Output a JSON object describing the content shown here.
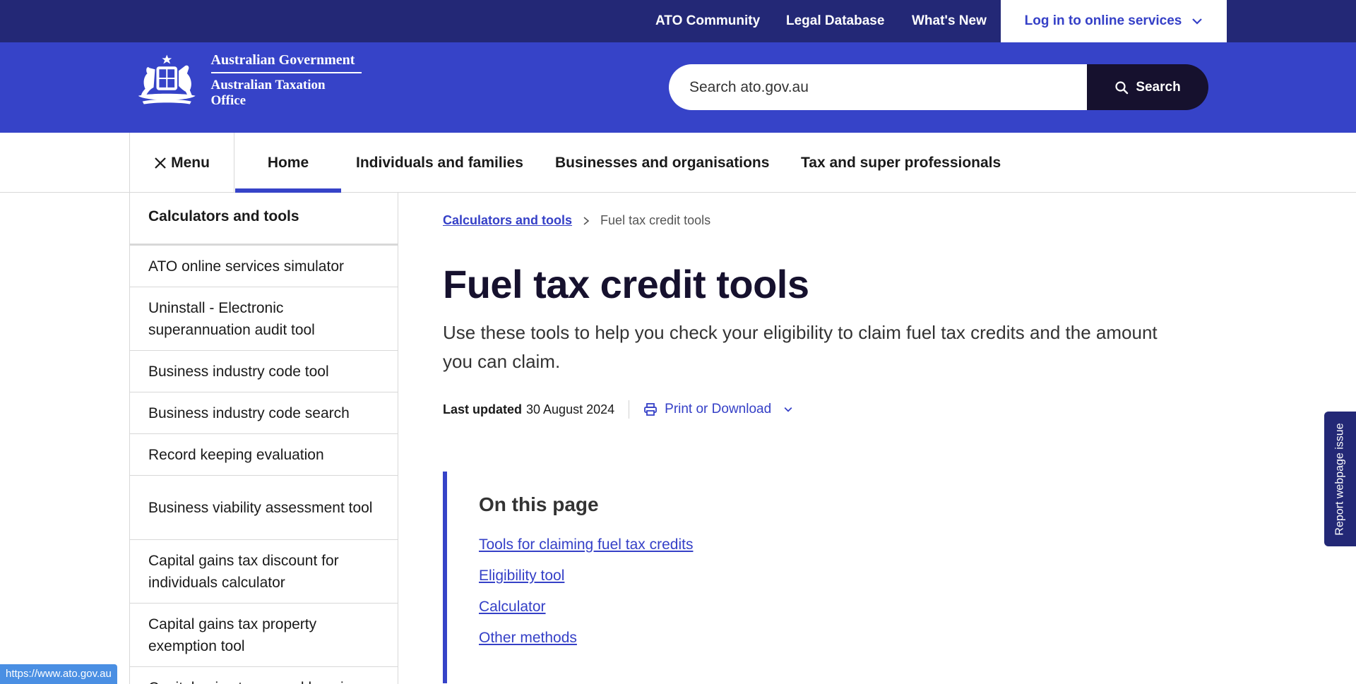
{
  "utility_bar": {
    "links": [
      "ATO Community",
      "Legal Database",
      "What's New"
    ],
    "login_label": "Log in to online services"
  },
  "header": {
    "logo_line1": "Australian Government",
    "logo_line2": "Australian Taxation Office",
    "search_placeholder": "Search ato.gov.au",
    "search_button": "Search"
  },
  "nav": {
    "menu_label": "Menu",
    "tabs": [
      "Home",
      "Individuals and families",
      "Businesses and organisations",
      "Tax and super professionals"
    ]
  },
  "sidebar": {
    "heading": "Calculators and tools",
    "items": [
      "ATO online services simulator",
      "Uninstall - Electronic superannuation audit tool",
      "Business industry code tool",
      "Business industry code search",
      "Record keeping evaluation",
      "Business viability assessment tool",
      "Capital gains tax discount for individuals calculator",
      "Capital gains tax property exemption tool",
      "Capital gains tax record keeping"
    ]
  },
  "breadcrumb": {
    "parent": "Calculators and tools",
    "current": "Fuel tax credit tools"
  },
  "content": {
    "title": "Fuel tax credit tools",
    "intro": "Use these tools to help you check your eligibility to claim fuel tax credits and the amount you can claim.",
    "last_updated_label": "Last updated",
    "last_updated_value": "30 August 2024",
    "print_label": "Print or Download"
  },
  "on_this_page": {
    "heading": "On this page",
    "links": [
      "Tools for claiming fuel tax credits",
      "Eligibility tool",
      "Calculator",
      "Other methods"
    ]
  },
  "report_tab": "Report webpage issue",
  "status_bar_url": "https://www.ato.gov.au",
  "colors": {
    "utility_bg": "#232876",
    "header_bg": "#3643c8",
    "link": "#3540c7",
    "search_button_bg": "#16112e"
  }
}
